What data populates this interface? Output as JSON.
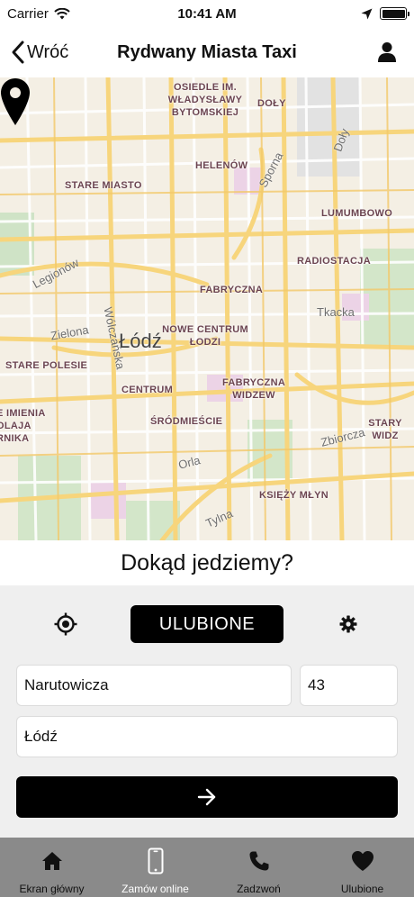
{
  "status_bar": {
    "carrier": "Carrier",
    "time": "10:41 AM"
  },
  "nav": {
    "back_label": "Wróć",
    "title": "Rydwany Miasta Taxi"
  },
  "map": {
    "districts": [
      "OSIEDLE IM. WŁADYSŁAWY BYTOMSKIEJ",
      "DOŁY",
      "HELENÓW",
      "STARE MIASTO",
      "LUMUMBOWO",
      "RADIOSTACJA",
      "FABRYCZNA",
      "NOWE CENTRUM ŁODZI",
      "STARE POLESIE",
      "CENTRUM",
      "FABRYCZNA WIDZEW",
      "ŚRÓDMIEŚCIE",
      "STARY WIDZ",
      "E IMIENIA OLAJA RNIKA",
      "KSIĘŻY MŁYN"
    ],
    "streets": [
      "Sporna",
      "Doły",
      "Legionów",
      "Zielona",
      "Wólczańska",
      "Tkacka",
      "Zbiorcza",
      "Orla",
      "Tylna"
    ],
    "city": "Łódź"
  },
  "question": "Dokąd jedziemy?",
  "panel": {
    "favorites_label": "ULUBIONE",
    "street_value": "Narutowicza",
    "number_value": "43",
    "city_value": "Łódź"
  },
  "tabs": [
    {
      "label": "Ekran główny",
      "icon": "home-icon"
    },
    {
      "label": "Zamów online",
      "icon": "phone-device-icon"
    },
    {
      "label": "Zadzwoń",
      "icon": "phone-call-icon"
    },
    {
      "label": "Ulubione",
      "icon": "heart-icon"
    }
  ],
  "colors": {
    "accent": "#000000",
    "tabbar": "#8a8a8a",
    "panel": "#efefef",
    "map_bg": "#f4efe4",
    "road": "#f7d57c",
    "district_label": "#6b4450"
  }
}
